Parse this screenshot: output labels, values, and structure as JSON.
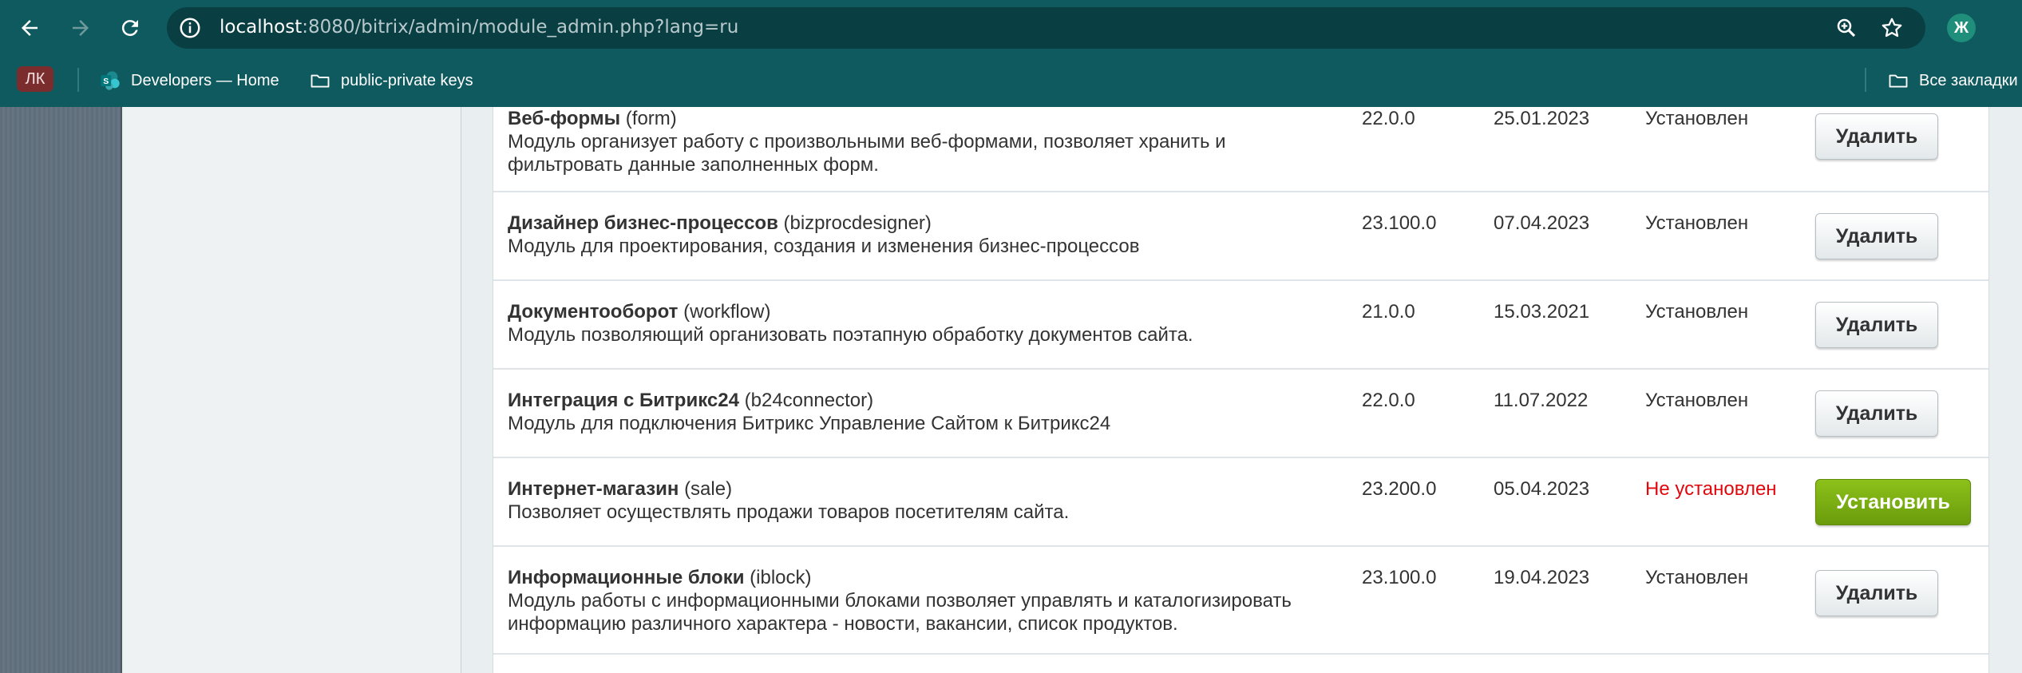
{
  "browser": {
    "url_host": "localhost",
    "url_rest": ":8080/bitrix/admin/module_admin.php?lang=ru",
    "profile_initial": "Ж"
  },
  "bookmarks": [
    {
      "label": "Developers — Home",
      "icon": "sharepoint-icon"
    },
    {
      "label": "public-private keys",
      "icon": "folder-icon"
    },
    {
      "label": "Все закладки",
      "icon": "folder-icon"
    }
  ],
  "bookmark_badge": "ЛК",
  "modules": [
    {
      "title": "Веб-формы",
      "code": "(form)",
      "description": "Модуль организует работу с произвольными веб-формами, позволяет хранить и фильтровать данные заполненных форм.",
      "version": "22.0.0",
      "date": "25.01.2023",
      "status": "Установлен",
      "action": "Удалить"
    },
    {
      "title": "Дизайнер бизнес-процессов",
      "code": "(bizprocdesigner)",
      "description": "Модуль для проектирования, создания и изменения бизнес-процессов",
      "version": "23.100.0",
      "date": "07.04.2023",
      "status": "Установлен",
      "action": "Удалить"
    },
    {
      "title": "Документооборот",
      "code": "(workflow)",
      "description": "Модуль позволяющий организовать поэтапную обработку документов сайта.",
      "version": "21.0.0",
      "date": "15.03.2021",
      "status": "Установлен",
      "action": "Удалить"
    },
    {
      "title": "Интеграция с Битрикс24",
      "code": "(b24connector)",
      "description": "Модуль для подключения Битрикс Управление Сайтом к Битрикс24",
      "version": "22.0.0",
      "date": "11.07.2022",
      "status": "Установлен",
      "action": "Удалить"
    },
    {
      "title": "Интернет-магазин",
      "code": "(sale)",
      "description": "Позволяет осуществлять продажи товаров посетителям сайта.",
      "version": "23.200.0",
      "date": "05.04.2023",
      "status": "Не установлен",
      "action": "Установить"
    },
    {
      "title": "Информационные блоки",
      "code": "(iblock)",
      "description": "Модуль работы с информационными блоками позволяет управлять и каталогизировать информацию различного характера - новости, вакансии, список продуктов.",
      "version": "23.100.0",
      "date": "19.04.2023",
      "status": "Установлен",
      "action": "Удалить"
    }
  ],
  "colors": {
    "browser_bar": "#0e5a5f",
    "status_not_installed": "#e0080d",
    "install_button": "#7cb014"
  }
}
